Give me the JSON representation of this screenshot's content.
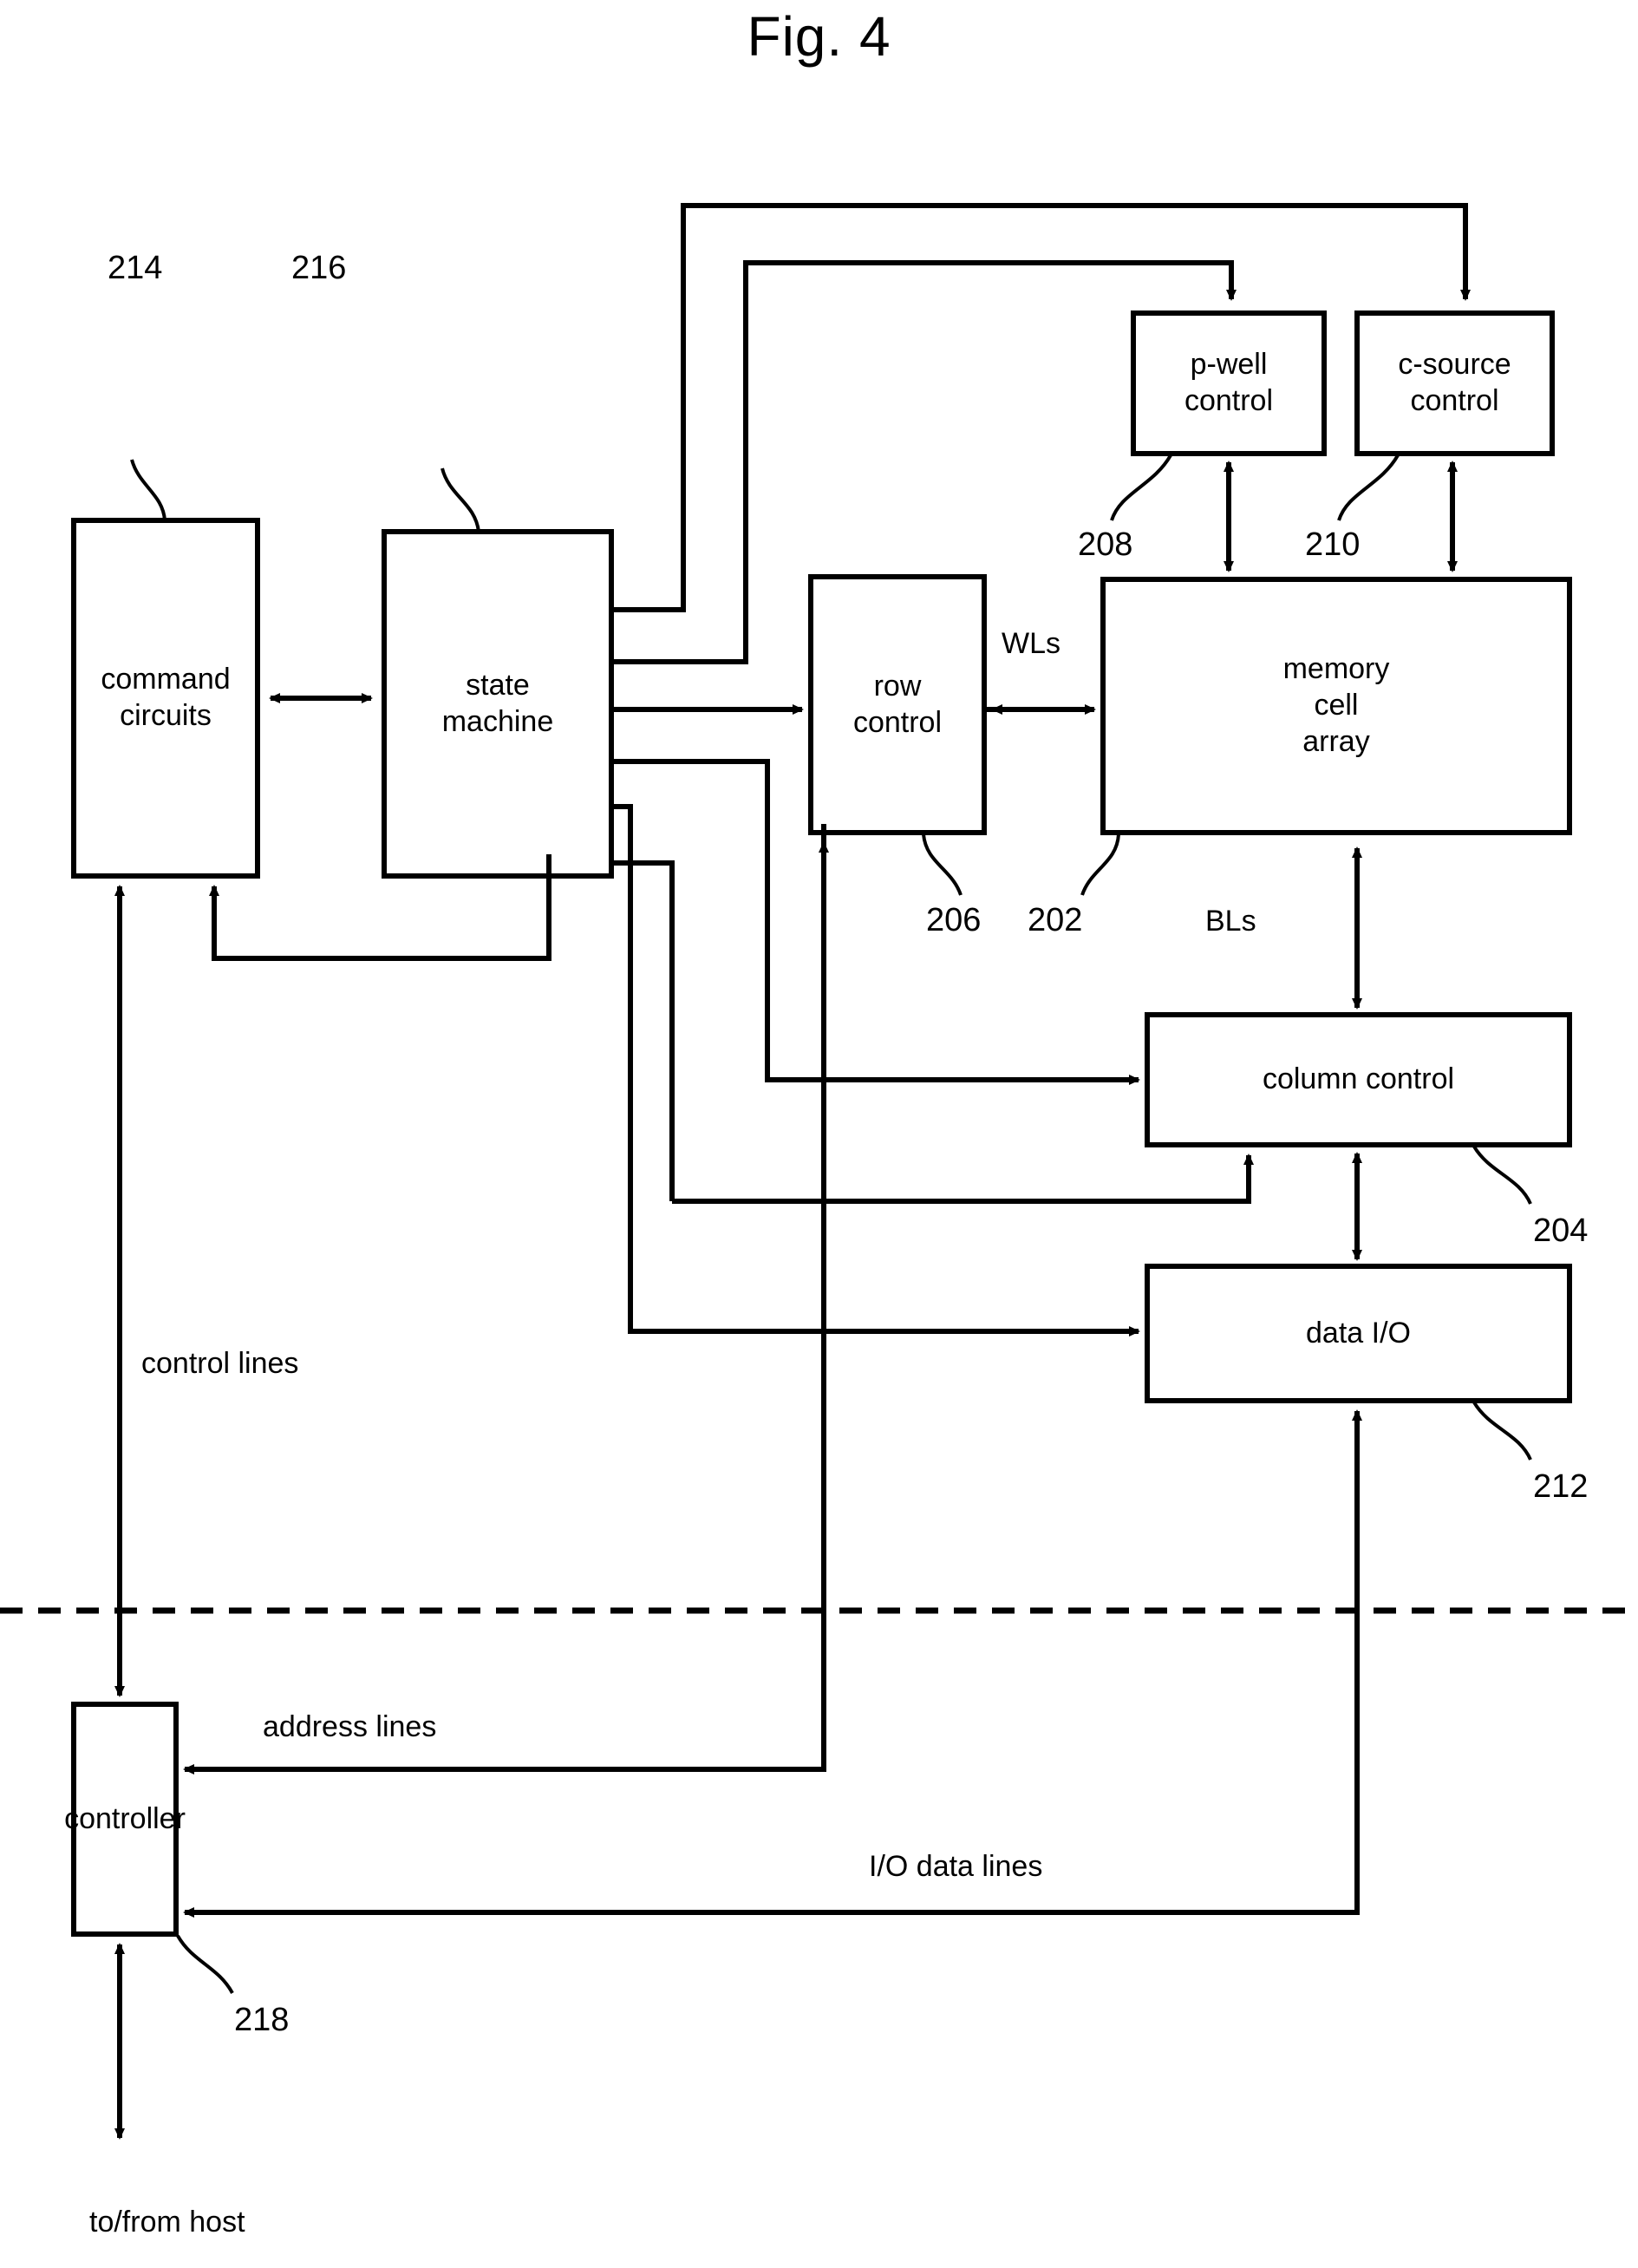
{
  "figure": {
    "title": "Fig. 4",
    "type": "block-diagram",
    "description": "Non-volatile memory system block diagram with controller below a dashed separation line"
  },
  "blocks": [
    {
      "id": "command_circuits",
      "label": "command\ncircuits",
      "ref": "214"
    },
    {
      "id": "state_machine",
      "label": "state\nmachine",
      "ref": "216"
    },
    {
      "id": "row_control",
      "label": "row\ncontrol",
      "ref": "206"
    },
    {
      "id": "memory_cell_array",
      "label": "memory\ncell\narray",
      "ref": "202"
    },
    {
      "id": "p_well_control",
      "label": "p-well\ncontrol",
      "ref": "208"
    },
    {
      "id": "c_source_control",
      "label": "c-source\ncontrol",
      "ref": "210"
    },
    {
      "id": "column_control",
      "label": "column control",
      "ref": "204"
    },
    {
      "id": "data_io",
      "label": "data I/O",
      "ref": "212"
    },
    {
      "id": "controller",
      "label": "controller",
      "ref": "218"
    }
  ],
  "block_labels": {
    "command_circuits_l1": "command",
    "command_circuits_l2": "circuits",
    "state_machine_l1": "state",
    "state_machine_l2": "machine",
    "row_control_l1": "row",
    "row_control_l2": "control",
    "memory_cell_array_l1": "memory",
    "memory_cell_array_l2": "cell",
    "memory_cell_array_l3": "array",
    "p_well_control_l1": "p-well",
    "p_well_control_l2": "control",
    "c_source_control_l1": "c-source",
    "c_source_control_l2": "control",
    "column_control": "column control",
    "data_io": "data I/O",
    "controller": "controller"
  },
  "reference_numerals": {
    "n214": "214",
    "n216": "216",
    "n208": "208",
    "n210": "210",
    "n206": "206",
    "n202": "202",
    "n204": "204",
    "n212": "212",
    "n218": "218"
  },
  "signal_labels": {
    "wls": "WLs",
    "bls": "BLs",
    "control_lines": "control lines",
    "address_lines": "address lines",
    "io_data_lines": "I/O data lines",
    "to_from_host": "to/from host"
  },
  "colors": {
    "stroke": "#000000",
    "background": "#ffffff",
    "text": "#000000"
  }
}
